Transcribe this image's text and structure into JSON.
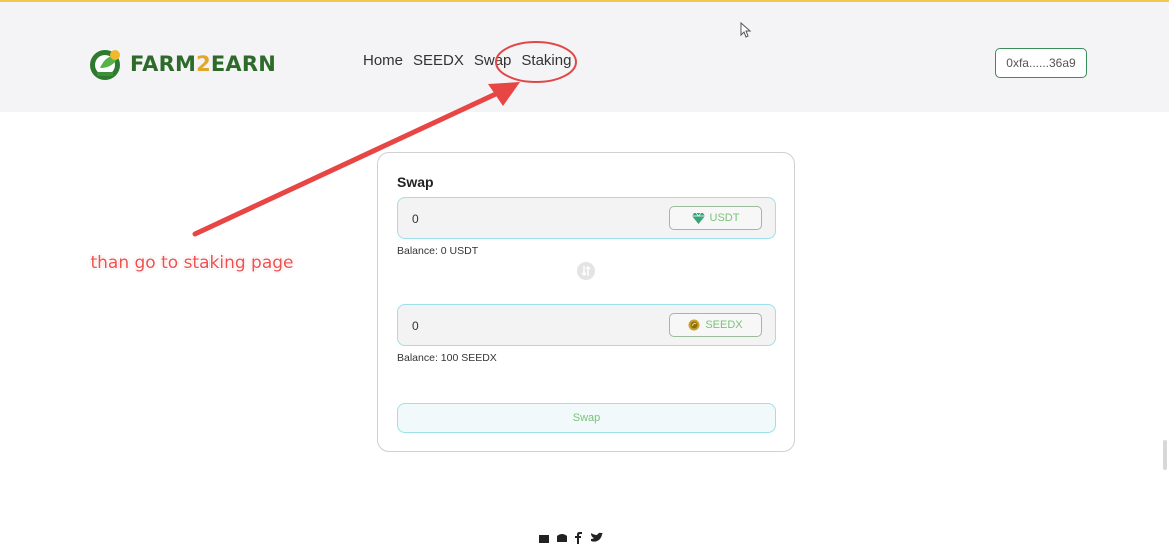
{
  "header": {
    "logo": {
      "prefix": "FARM",
      "middle": "2",
      "suffix": "EARN"
    },
    "nav": [
      {
        "label": "Home"
      },
      {
        "label": "SEEDX"
      },
      {
        "label": "Swap"
      },
      {
        "label": "Staking"
      }
    ],
    "wallet_address": "0xfa......36a9"
  },
  "swap_card": {
    "title": "Swap",
    "from": {
      "value": "0",
      "token": "USDT",
      "balance": "Balance: 0 USDT"
    },
    "to": {
      "value": "0",
      "token": "SEEDX",
      "balance": "Balance: 100 SEEDX"
    },
    "swap_button": "Swap"
  },
  "annotation": {
    "text": "than go to staking page",
    "color": "#f05050"
  },
  "colors": {
    "accent_green": "#2e6b2a",
    "accent_gold": "#e0a82a",
    "field_border": "#9be0ea",
    "token_text": "#7ac27a"
  },
  "icons": {
    "usdt": "gem-icon",
    "seedx": "coin-icon",
    "switch": "swap-direction-icon",
    "footer": [
      "mail-icon",
      "discord-icon",
      "facebook-icon",
      "twitter-icon"
    ]
  }
}
